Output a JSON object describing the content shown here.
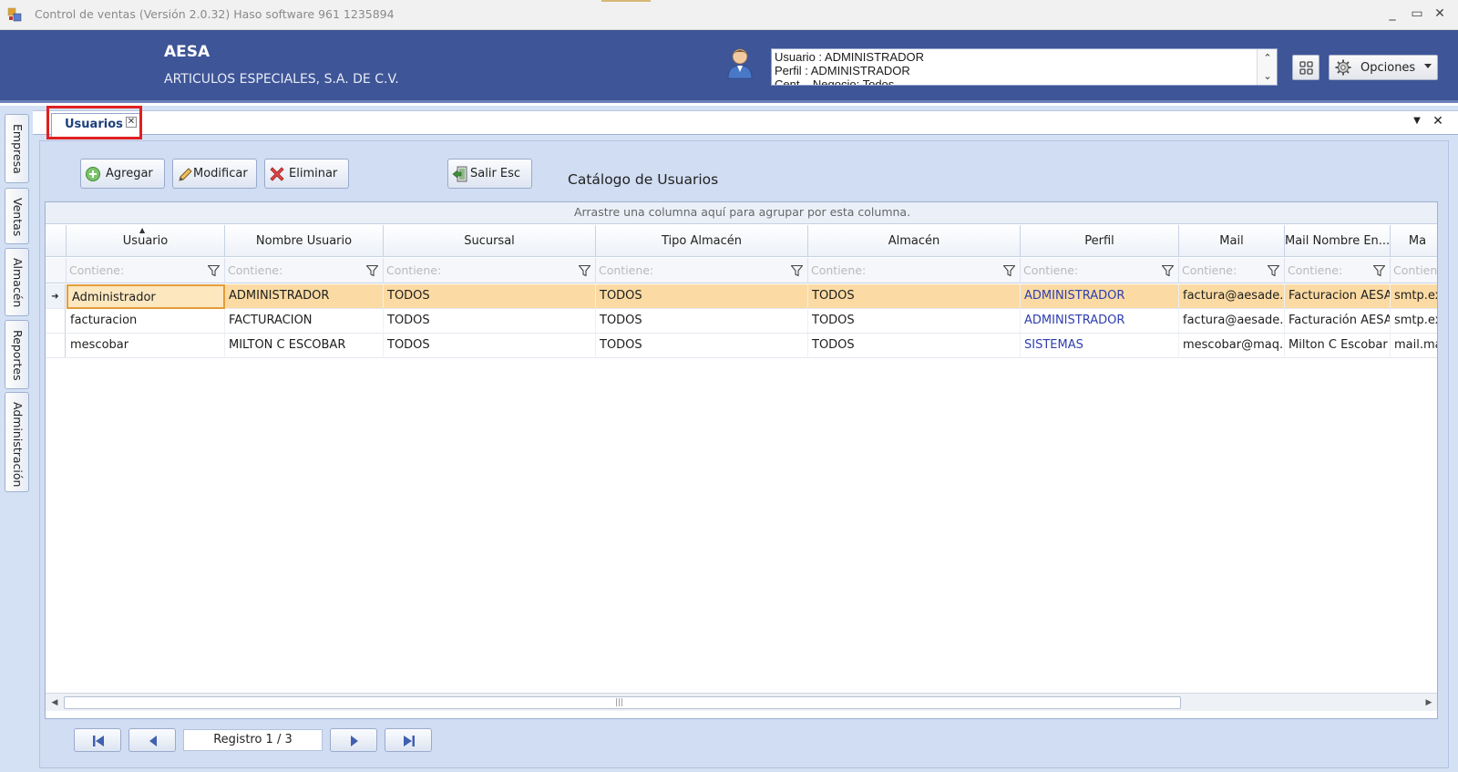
{
  "window": {
    "title": "Control de ventas  (Versión 2.0.32)  Haso software  961 1235894",
    "app_icon": "app-window-icon",
    "minimize": "_",
    "restore": "▭",
    "close": "✕"
  },
  "header": {
    "company_short": "AESA",
    "company_full": "ARTICULOS ESPECIALES, S.A. DE C.V.",
    "user_icon": "user-avatar-icon",
    "userinfo_lines": [
      "Usuario : ADMINISTRADOR",
      "Perfil : ADMINISTRADOR",
      "Cent... Negocio: Todos"
    ],
    "scroll_up": "⌃",
    "scroll_down": "⌄",
    "opciones_label": "Opciones"
  },
  "left_tabs": [
    "Empresa",
    "Ventas",
    "Almacén",
    "Reportes",
    "Administración"
  ],
  "doc_tab": {
    "label": "Usuarios",
    "close": "✕",
    "menu_glyph": "▼",
    "close_all": "✕"
  },
  "toolbar": {
    "agregar": "Agregar",
    "modificar": "Modificar",
    "eliminar": "Eliminar",
    "salir": "Salir  Esc",
    "catalog_title": "Catálogo de Usuarios"
  },
  "grid": {
    "group_hint": "Arrastre una columna aquí para agrupar por esta columna.",
    "filter_placeholder": "Contiene:",
    "sort_indicator": "▲",
    "columns": [
      "Usuario",
      "Nombre Usuario",
      "Sucursal",
      "Tipo Almacén",
      "Almacén",
      "Perfil",
      "Mail",
      "Mail Nombre En...",
      "Ma"
    ],
    "rows": [
      [
        "Administrador",
        "ADMINISTRADOR",
        "TODOS",
        "TODOS",
        "TODOS",
        "ADMINISTRADOR",
        "factura@aesade...",
        "Facturacion AESA",
        "smtp.ex"
      ],
      [
        "facturacion",
        "FACTURACION",
        "TODOS",
        "TODOS",
        "TODOS",
        "ADMINISTRADOR",
        "factura@aesade...",
        "Facturación AESA",
        "smtp.ex"
      ],
      [
        "mescobar",
        "MILTON C ESCOBAR",
        "TODOS",
        "TODOS",
        "TODOS",
        "SISTEMAS",
        "mescobar@maq...",
        "Milton C Escobar",
        "mail.ma"
      ]
    ],
    "selected_row": 0,
    "row_indicator": "➜"
  },
  "scrollbar": {
    "left": "◀",
    "right": "▶",
    "grip": "|||"
  },
  "navigator": {
    "registro": "Registro  1 / 3"
  },
  "colors": {
    "header_bg": "#3e5597",
    "panel_bg": "#d0ddf2",
    "selected_row": "#fbdba3",
    "highlight_box": "#e02020",
    "link": "#2e3eae"
  }
}
